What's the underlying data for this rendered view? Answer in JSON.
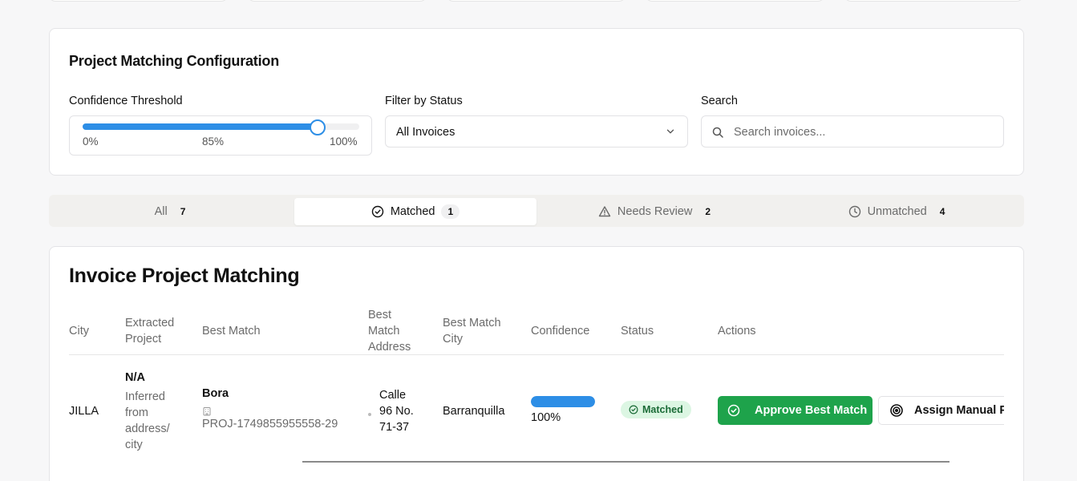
{
  "config": {
    "title": "Project Matching Configuration",
    "threshold": {
      "label": "Confidence Threshold",
      "value_percent": 85,
      "tick_min": "0%",
      "tick_mid": "85%",
      "tick_max": "100%"
    },
    "status_filter": {
      "label": "Filter by Status",
      "selected": "All Invoices"
    },
    "search": {
      "label": "Search",
      "placeholder": "Search invoices...",
      "value": ""
    }
  },
  "tabs": [
    {
      "label": "All",
      "count": "7",
      "icon": "none",
      "active": false
    },
    {
      "label": "Matched",
      "count": "1",
      "icon": "check-circle-icon",
      "active": true
    },
    {
      "label": "Needs Review",
      "count": "2",
      "icon": "warning-triangle-icon",
      "active": false
    },
    {
      "label": "Unmatched",
      "count": "4",
      "icon": "clock-icon",
      "active": false
    }
  ],
  "table": {
    "title": "Invoice Project Matching",
    "columns": {
      "city": "City",
      "extracted_project_1": "Extracted",
      "extracted_project_2": "Project",
      "best_match": "Best Match",
      "best_match_address_1": "Best",
      "best_match_address_2": "Match",
      "best_match_address_3": "Address",
      "best_match_city_1": "Best Match",
      "best_match_city_2": "City",
      "confidence": "Confidence",
      "status": "Status",
      "actions": "Actions"
    },
    "rows": [
      {
        "city": "JILLA",
        "extracted_project": "N/A",
        "extracted_note_1": "Inferred",
        "extracted_note_2": "from",
        "extracted_note_3": "address/",
        "extracted_note_4": "city",
        "best_match_name": "Bora",
        "best_match_id": "PROJ-1749855955558-29",
        "best_match_id_icon": "building-icon",
        "address_1": "Calle",
        "address_2": "96 No.",
        "address_3": "71-37",
        "address_icon": "map-pin-icon",
        "best_match_city": "Barranquilla",
        "confidence_value": 100,
        "confidence_label": "100%",
        "status": "Matched",
        "approve_label": "Approve Best Match",
        "assign_label": "Assign Manual Pr"
      }
    ]
  },
  "colors": {
    "accent_blue": "#2d8ee6",
    "approve_green": "#1ea34b",
    "matched_badge_bg": "#dcf6e3",
    "matched_badge_text": "#1b6b37"
  }
}
